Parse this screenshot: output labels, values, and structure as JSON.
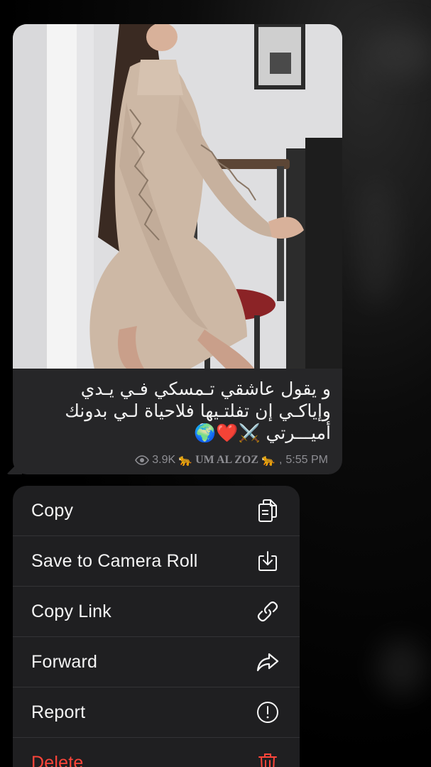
{
  "message": {
    "caption_lines": [
      "و يقول عاشقي تـمسكي فـي يـدي",
      "وإياكـي إن تفلتـيها فلاحياة لـي بدونك",
      "أميـــرتي ⚔️❤️🌍"
    ],
    "views": "3.9K",
    "channel_name": "UM AL ZOZ",
    "channel_emoji": "🐆",
    "time": "5:55 PM",
    "separator": ","
  },
  "context_menu": {
    "items": [
      {
        "label": "Copy",
        "icon": "copy-icon"
      },
      {
        "label": "Save to Camera Roll",
        "icon": "download-icon"
      },
      {
        "label": "Copy Link",
        "icon": "link-icon"
      },
      {
        "label": "Forward",
        "icon": "forward-arrow-icon"
      },
      {
        "label": "Report",
        "icon": "exclamation-circle-icon"
      },
      {
        "label": "Delete",
        "icon": "trash-icon"
      }
    ]
  },
  "colors": {
    "bubble": "#262628",
    "menu": "#1f1f21",
    "danger": "#ff453a",
    "meta_text": "#8e8e93"
  }
}
